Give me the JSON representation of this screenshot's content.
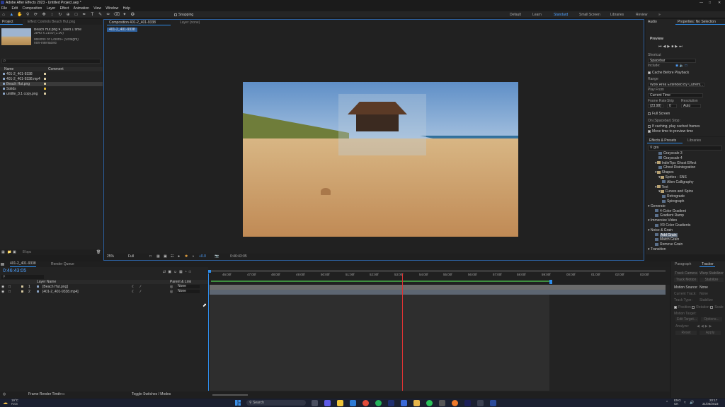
{
  "titlebar": {
    "title": "Adobe After Effects 2023 - Untitled Project.aep *"
  },
  "menu": [
    "File",
    "Edit",
    "Composition",
    "Layer",
    "Effect",
    "Animation",
    "View",
    "Window",
    "Help"
  ],
  "toolbar": {
    "snapping_label": "Snapping"
  },
  "workspaces": [
    "Default",
    "Learn",
    "Standard",
    "Small Screen",
    "Libraries",
    "Review"
  ],
  "workspace_active": "Standard",
  "project": {
    "tab": "Project",
    "effect_controls_tab": "Effect Controls Beach Hut.png",
    "preview_name": "Beach Hut.png ▾ , used 1 time",
    "preview_size": "3840 x 2160 (1.00)",
    "preview_colors": "Millions of Colors+ (Straight)",
    "preview_interlace": "non-interlaced",
    "search_placeholder": "ρ",
    "col_name": "Name",
    "col_comment": "Comment",
    "items": [
      {
        "name": "401-2_401-9338",
        "color": "#d7c9a0"
      },
      {
        "name": "401-2_401-9338.mp4",
        "color": "#d7c9a0"
      },
      {
        "name": "Beach Hut.png",
        "color": "#d7c9a0"
      },
      {
        "name": "Solids",
        "color": "#e2b934"
      },
      {
        "name": "untitle_3.1 copy.png",
        "color": "#d7c9a0"
      }
    ],
    "bpc": "8 bpc"
  },
  "composition": {
    "tab": "Composition 401-2_401-9338",
    "layer_tab": "Layer (none)",
    "sub_tab": "401-2_401-9338",
    "zoom": "25%",
    "quality": "Full",
    "offset": "+0.0",
    "timecode": "0:46:43:05"
  },
  "info_panel": {
    "audio_tab": "Audio",
    "properties_tab": "Properties: No Selection",
    "preview_title": "Preview",
    "shortcut_label": "Shortcut",
    "shortcut_value": "Spacebar",
    "include_label": "Include:",
    "cache_label": "Cache Before Playback",
    "range_label": "Range",
    "range_value": "Work Area Extended By Current...",
    "play_from_label": "Play From",
    "play_from_value": "Current Time",
    "frame_rate_label": "Frame Rate",
    "skip_label": "Skip",
    "resolution_label": "Resolution",
    "frame_rate_value": "(23.98)",
    "skip_value": "0",
    "resolution_value": "Auto",
    "full_screen_label": "Full Screen",
    "on_stop_label": "On (Spacebar) Stop:",
    "if_caching_label": "If caching, play cached frames",
    "move_time_label": "Move time to preview time"
  },
  "effects": {
    "tab": "Effects & Presets",
    "libraries_tab": "Libraries",
    "search_value": "gra",
    "items": [
      {
        "label": "Grayscale 3",
        "kind": "file",
        "indent": 3
      },
      {
        "label": "Grayscale 4",
        "kind": "file",
        "indent": 3
      },
      {
        "label": "IndieTips Ghost Effect",
        "kind": "folder",
        "indent": 2
      },
      {
        "label": "Ghost Disintegration",
        "kind": "file",
        "indent": 3
      },
      {
        "label": "Shapes",
        "kind": "folder",
        "indent": 2
      },
      {
        "label": "Sprites - SNS",
        "kind": "folder",
        "indent": 3
      },
      {
        "label": "Alien Calligraphy",
        "kind": "file",
        "indent": 4
      },
      {
        "label": "Text",
        "kind": "folder",
        "indent": 2
      },
      {
        "label": "Curves and Spins",
        "kind": "folder",
        "indent": 3
      },
      {
        "label": "Retrograde",
        "kind": "file",
        "indent": 4
      },
      {
        "label": "Spirograph",
        "kind": "file",
        "indent": 4
      },
      {
        "label": "Generate",
        "kind": "cat",
        "indent": 0
      },
      {
        "label": "4-Color Gradient",
        "kind": "file",
        "indent": 2
      },
      {
        "label": "Gradient Ramp",
        "kind": "file",
        "indent": 2
      },
      {
        "label": "Immersive Video",
        "kind": "cat",
        "indent": 0
      },
      {
        "label": "VR Color Gradients",
        "kind": "file",
        "indent": 2
      },
      {
        "label": "Noise & Grain",
        "kind": "cat",
        "indent": 0
      },
      {
        "label": "Add Grain",
        "kind": "file",
        "indent": 2,
        "highlight": true
      },
      {
        "label": "Match Grain",
        "kind": "file",
        "indent": 2
      },
      {
        "label": "Remove Grain",
        "kind": "file",
        "indent": 2
      },
      {
        "label": "Transition",
        "kind": "cat",
        "indent": 0
      }
    ]
  },
  "timeline": {
    "comp_tab": "401-2_401-9338",
    "render_queue_tab": "Render Queue",
    "timecode": "0:46:43:05",
    "col_layer_name": "Layer Name",
    "col_parent": "Parent & Link",
    "layers": [
      {
        "num": "1",
        "name": "[Beach Hut.png]",
        "parent": "None"
      },
      {
        "num": "2",
        "name": "[401-2_401-9338.mp4]",
        "parent": "None"
      }
    ],
    "ticks": [
      "46:00f",
      "47:00f",
      "48:00f",
      "49:00f",
      "50:00f",
      "51:00f",
      "52:00f",
      "53:00f",
      "54:00f",
      "55:00f",
      "56:00f",
      "57:00f",
      "58:00f",
      "59:00f",
      "00:00f",
      "01:00f",
      "02:00f",
      "03:00f"
    ],
    "frame_render_label": "Frame Render Time:",
    "frame_render_value": "0ms",
    "toggle_label": "Toggle Switches / Modes"
  },
  "tracker": {
    "paragraph_tab": "Paragraph",
    "tracker_tab": "Tracker",
    "btn_track_camera": "Track Camera",
    "btn_warp_stabilizer": "Warp Stabilizer",
    "btn_track_motion": "Track Motion",
    "btn_stabilize_motion": "Stabilize Motion",
    "motion_source_label": "Motion Source:",
    "motion_source_value": "None",
    "current_track_label": "Current Track:",
    "current_track_value": "None",
    "track_type_label": "Track Type:",
    "track_type_value": "Stabilize",
    "position_label": "Position",
    "rotation_label": "Rotation",
    "scale_label": "Scale",
    "motion_target_label": "Motion Target:",
    "edit_target_label": "Edit Target...",
    "options_label": "Options...",
    "analyze_label": "Analyze:",
    "reset_label": "Reset",
    "apply_label": "Apply"
  },
  "taskbar": {
    "weather_temp": "19°C",
    "weather_desc": "Rain",
    "search_placeholder": "Search",
    "lang_top": "ENG",
    "lang_bottom": "UK",
    "time": "20:17",
    "date": "31/08/2023"
  }
}
